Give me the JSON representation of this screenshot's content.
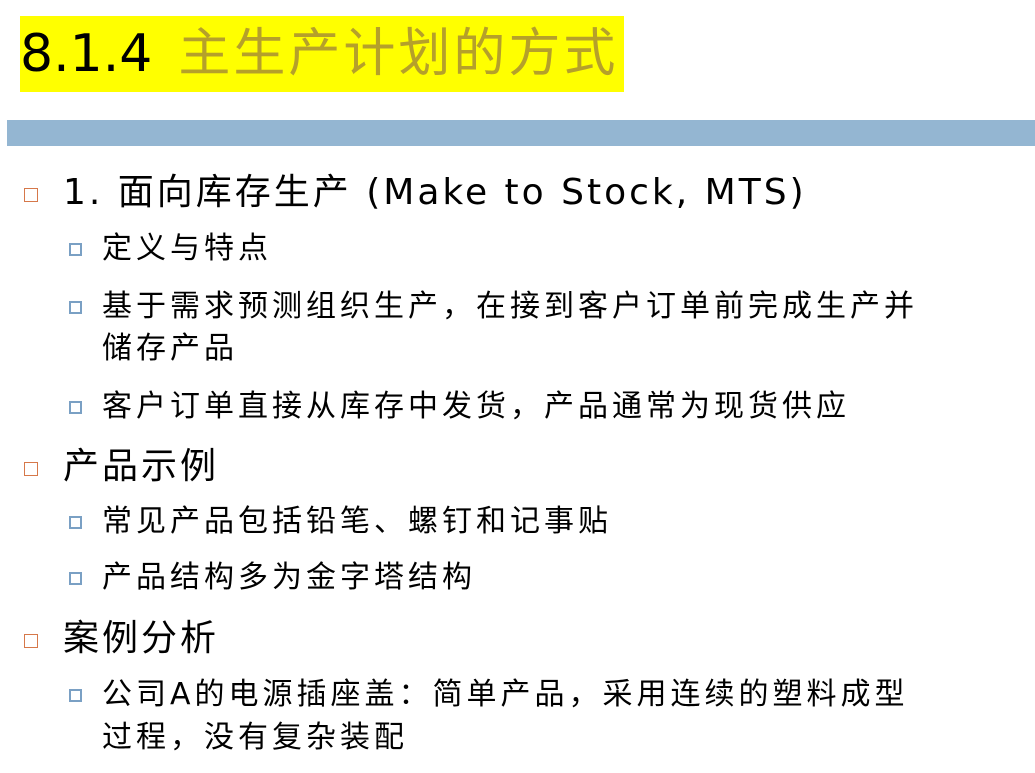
{
  "slide": {
    "title_number": "8.1.4",
    "title_text": "主生产计划的方式"
  },
  "bullets": [
    {
      "text": "1. 面向库存生产 (Make to Stock, MTS)"
    },
    {
      "text": "定义与特点"
    },
    {
      "text": "基于需求预测组织生产，在接到客户订单前完成生产并"
    },
    {
      "text": "储存产品"
    },
    {
      "text": "客户订单直接从库存中发货，产品通常为现货供应"
    },
    {
      "text": "产品示例"
    },
    {
      "text": "常见产品包括铅笔、螺钉和记事贴"
    },
    {
      "text": "产品结构多为金字塔结构"
    },
    {
      "text": "案例分析"
    },
    {
      "text": "公司A的电源插座盖：简单产品，采用连续的塑料成型"
    },
    {
      "text": "过程，没有复杂装配"
    }
  ],
  "colors": {
    "title_highlight": "#ffff00",
    "title_text": "#b5a02a",
    "header_bar": "#94b6d2",
    "level1_bullet": "#d6784a",
    "level2_bullet": "#7aa0c4"
  }
}
